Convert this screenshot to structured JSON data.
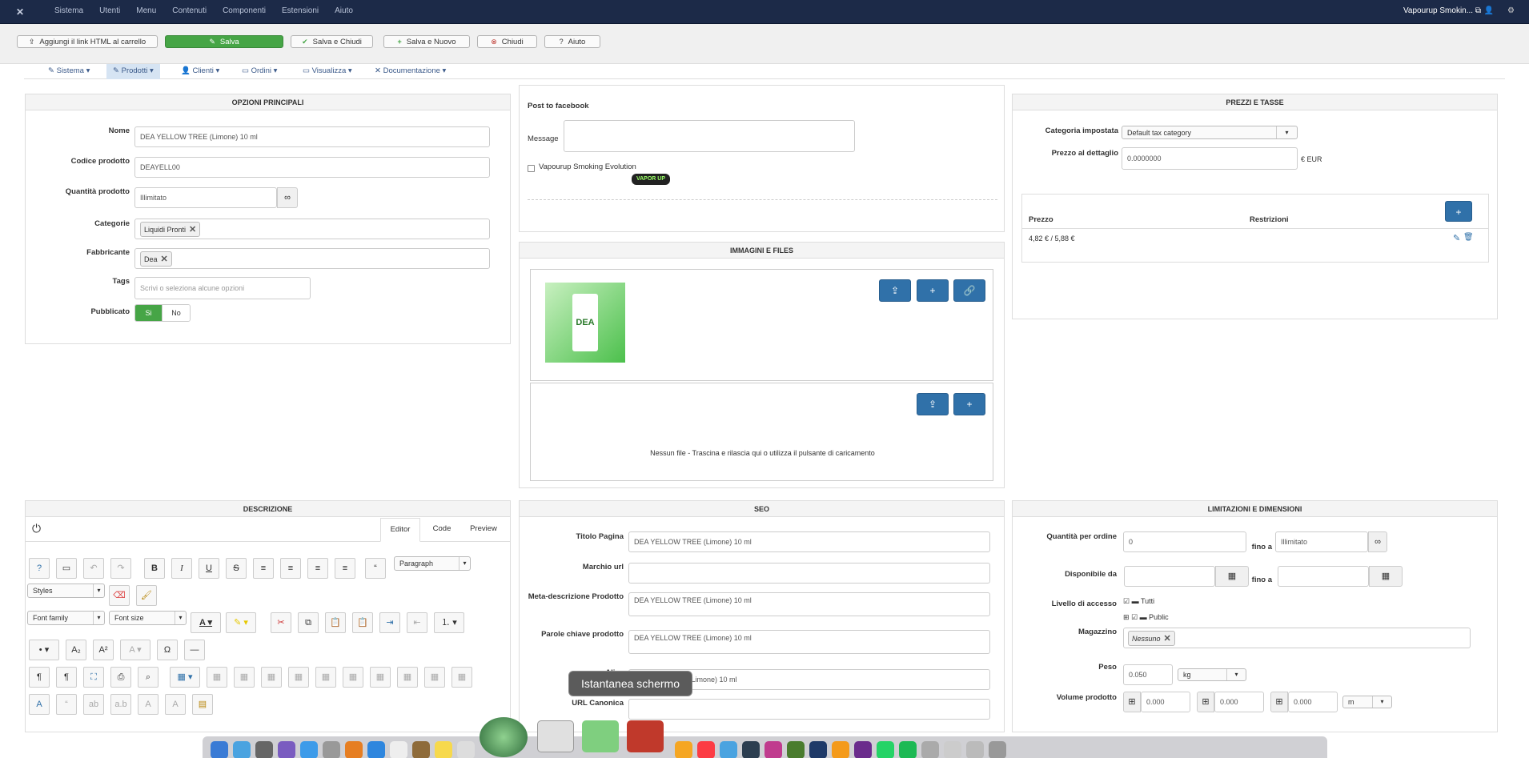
{
  "topnav": {
    "menu": [
      "Sistema",
      "Utenti",
      "Menu",
      "Contenuti",
      "Componenti",
      "Estensioni",
      "Aiuto"
    ],
    "site_name": "Vapourup Smokin...",
    "site_icon": "external-link-icon",
    "user_icon": "user-icon",
    "settings_icon": "gear-icon"
  },
  "toolbar": {
    "add_link": "Aggiungi il link HTML al carrello",
    "save": "Salva",
    "save_close": "Salva e Chiudi",
    "save_new": "Salva e Nuovo",
    "close": "Chiudi",
    "help": "Aiuto"
  },
  "subnav": [
    "Sistema",
    "Prodotti",
    "Clienti",
    "Ordini",
    "Visualizza",
    "Documentazione"
  ],
  "main_options": {
    "title": "OPZIONI PRINCIPALI",
    "name_label": "Nome",
    "name_value": "DEA YELLOW TREE (Limone) 10 ml",
    "code_label": "Codice prodotto",
    "code_value": "DEAYELL00",
    "qty_label": "Quantità prodotto",
    "qty_value": "Illimitato",
    "cat_label": "Categorie",
    "cat_tag": "Liquidi Pronti",
    "mfr_label": "Fabbricante",
    "mfr_tag": "Dea",
    "tags_label": "Tags",
    "tags_placeholder": "Scrivi o seleziona alcune opzioni",
    "pub_label": "Pubblicato",
    "pub_yes": "Si",
    "pub_no": "No"
  },
  "facebook": {
    "title": "Post to facebook",
    "message_label": "Message",
    "page_name": "Vapourup Smoking Evolution",
    "logo_text": "VAPOR UP"
  },
  "prices": {
    "title": "PREZZI E TASSE",
    "cat_label": "Categoria impostata",
    "cat_value": "Default tax category",
    "retail_label": "Prezzo al dettaglio",
    "retail_value": "0.0000000",
    "currency": "€ EUR",
    "col_price": "Prezzo",
    "col_restrictions": "Restrizioni",
    "row_price": "4,82 € / 5,88 €"
  },
  "images": {
    "title": "IMMAGINI E FILES",
    "no_files": "Nessun file - Trascina e rilascia qui o utilizza il pulsante di caricamento",
    "product_text": "DEA"
  },
  "description": {
    "title": "DESCRIZIONE",
    "tab_editor": "Editor",
    "tab_code": "Code",
    "tab_preview": "Preview",
    "paragraph": "Paragraph",
    "styles": "Styles",
    "font_family": "Font family",
    "font_size": "Font size"
  },
  "seo": {
    "title": "SEO",
    "page_title_label": "Titolo Pagina",
    "page_title_value": "DEA YELLOW TREE (Limone) 10 ml",
    "url_mark_label": "Marchio url",
    "meta_label": "Meta-descrizione Prodotto",
    "meta_value": "DEA YELLOW TREE (Limone) 10 ml",
    "keywords_label": "Parole chiave prodotto",
    "keywords_value": "DEA YELLOW TREE (Limone) 10 ml",
    "alias_label": "Alias",
    "alias_value": "E (Limone) 10 ml",
    "canonical_label": "URL Canonica"
  },
  "limits": {
    "title": "LIMITAZIONI E DIMENSIONI",
    "qty_order_label": "Quantità per ordine",
    "qty_min": "0",
    "to": "fino a",
    "qty_max": "Illimitato",
    "available_label": "Disponibile da",
    "access_label": "Livello di accesso",
    "access_all": "Tutti",
    "access_public": "Public",
    "warehouse_label": "Magazzino",
    "warehouse_tag": "Nessuno",
    "weight_label": "Peso",
    "weight_value": "0.050",
    "weight_unit": "kg",
    "volume_label": "Volume prodotto",
    "vol1": "0.000",
    "vol2": "0.000",
    "vol3": "0.000",
    "vol_unit": "m"
  },
  "tooltip": "Istantanea schermo"
}
